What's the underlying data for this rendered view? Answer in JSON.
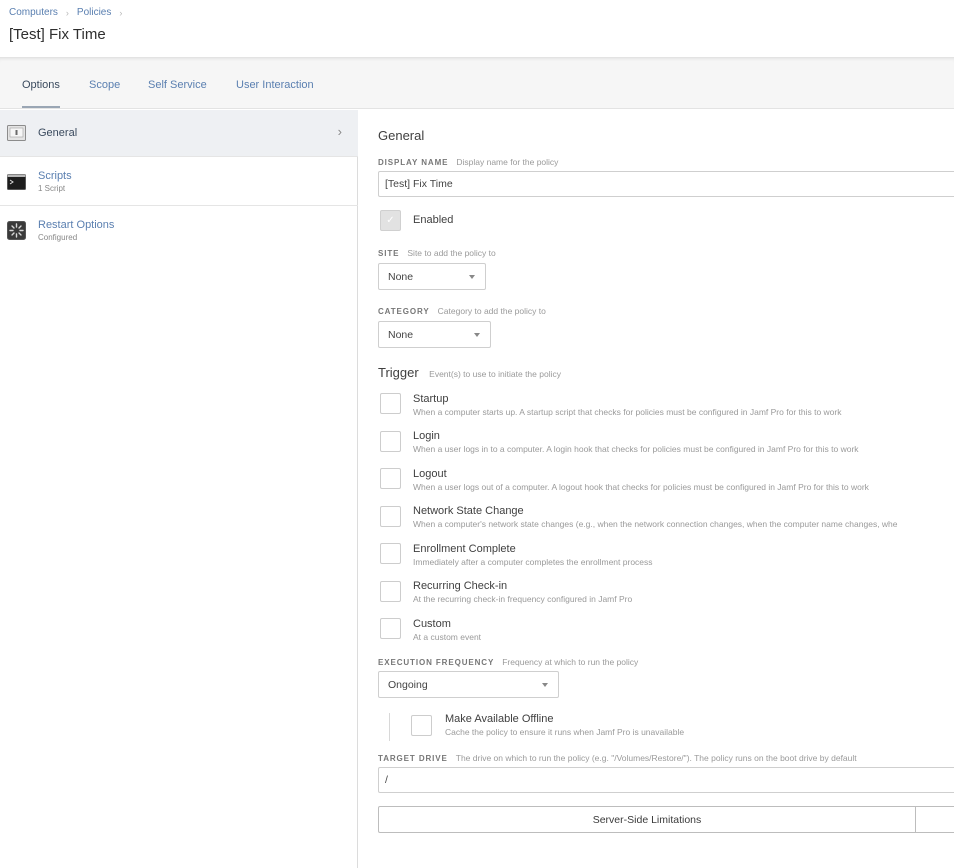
{
  "breadcrumb": {
    "items": [
      "Computers",
      "Policies"
    ],
    "sep": "›"
  },
  "page_title": "[Test] Fix Time",
  "tabs": [
    {
      "label": "Options",
      "active": true
    },
    {
      "label": "Scope",
      "active": false
    },
    {
      "label": "Self Service",
      "active": false
    },
    {
      "label": "User Interaction",
      "active": false
    }
  ],
  "sidebar": {
    "items": [
      {
        "label": "General",
        "sub": "",
        "icon": "general-icon",
        "active": true
      },
      {
        "label": "Scripts",
        "sub": "1 Script",
        "icon": "terminal-icon",
        "active": false
      },
      {
        "label": "Restart Options",
        "sub": "Configured",
        "icon": "restart-icon",
        "active": false
      }
    ],
    "chevron": "›"
  },
  "general": {
    "title": "General",
    "display_name": {
      "label": "DISPLAY NAME",
      "help": "Display name for the policy",
      "value": "[Test] Fix Time"
    },
    "enabled": {
      "label": "Enabled",
      "checked": true,
      "check_glyph": "✓"
    },
    "site": {
      "label": "SITE",
      "help": "Site to add the policy to",
      "value": "None"
    },
    "category": {
      "label": "CATEGORY",
      "help": "Category to add the policy to",
      "value": "None"
    }
  },
  "trigger": {
    "title": "Trigger",
    "help": "Event(s) to use to initiate the policy",
    "items": [
      {
        "label": "Startup",
        "desc": "When a computer starts up. A startup script that checks for policies must be configured in Jamf Pro for this to work"
      },
      {
        "label": "Login",
        "desc": "When a user logs in to a computer. A login hook that checks for policies must be configured in Jamf Pro for this to work"
      },
      {
        "label": "Logout",
        "desc": "When a user logs out of a computer. A logout hook that checks for policies must be configured in Jamf Pro for this to work"
      },
      {
        "label": "Network State Change",
        "desc": "When a computer's network state changes (e.g., when the network connection changes, when the computer name changes, whe"
      },
      {
        "label": "Enrollment Complete",
        "desc": "Immediately after a computer completes the enrollment process"
      },
      {
        "label": "Recurring Check-in",
        "desc": "At the recurring check-in frequency configured in Jamf Pro"
      },
      {
        "label": "Custom",
        "desc": "At a custom event"
      }
    ]
  },
  "execution": {
    "label": "EXECUTION FREQUENCY",
    "help": "Frequency at which to run the policy",
    "value": "Ongoing",
    "offline": {
      "label": "Make Available Offline",
      "desc": "Cache the policy to ensure it runs when Jamf Pro is unavailable"
    }
  },
  "target_drive": {
    "label": "TARGET DRIVE",
    "help": "The drive on which to run the policy (e.g. \"/Volumes/Restore/\"). The policy runs on the boot drive by default",
    "value": "/"
  },
  "server_side": {
    "label": "Server-Side Limitations"
  }
}
